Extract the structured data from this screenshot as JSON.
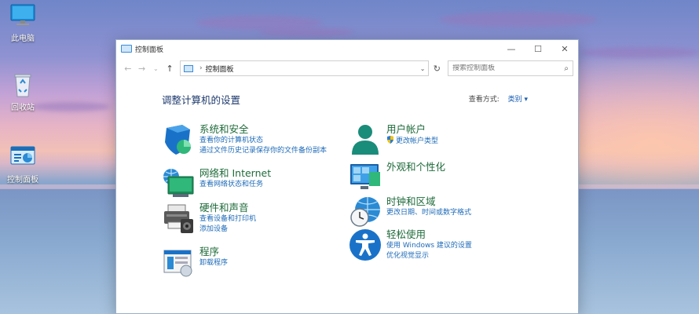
{
  "desktop": {
    "icons": [
      {
        "label": "此电脑"
      },
      {
        "label": "回收站"
      },
      {
        "label": "控制面板"
      }
    ]
  },
  "window": {
    "title": "控制面板",
    "controls": {
      "minimize": "—",
      "maximize": "☐",
      "close": "✕"
    },
    "nav": {
      "back": "←",
      "forward": "→",
      "history": "⌄",
      "up": "↑",
      "breadcrumb_sep": "›",
      "breadcrumb": "控制面板",
      "dropdown": "⌄",
      "refresh": "↻"
    },
    "search": {
      "placeholder": "搜索控制面板",
      "icon": "search-icon"
    },
    "heading": "调整计算机的设置",
    "view_by": {
      "label": "查看方式:",
      "value": "类别 ▾"
    }
  },
  "categories": {
    "security": {
      "title": "系统和安全",
      "links": [
        "查看你的计算机状态",
        "通过文件历史记录保存你的文件备份副本"
      ]
    },
    "network": {
      "title": "网络和 Internet",
      "links": [
        "查看网络状态和任务"
      ]
    },
    "hardware": {
      "title": "硬件和声音",
      "links": [
        "查看设备和打印机",
        "添加设备"
      ]
    },
    "programs": {
      "title": "程序",
      "links": [
        "卸载程序"
      ]
    },
    "accounts": {
      "title": "用户帐户",
      "links": [
        "更改帐户类型"
      ]
    },
    "appearance": {
      "title": "外观和个性化",
      "links": []
    },
    "clock": {
      "title": "时钟和区域",
      "links": [
        "更改日期、时间或数字格式"
      ]
    },
    "ease": {
      "title": "轻松使用",
      "links": [
        "使用 Windows 建议的设置",
        "优化视觉显示"
      ]
    }
  },
  "colors": {
    "accent": "#1e6bb8",
    "category_title": "#1e6b3a",
    "heading": "#1e3a6e"
  }
}
